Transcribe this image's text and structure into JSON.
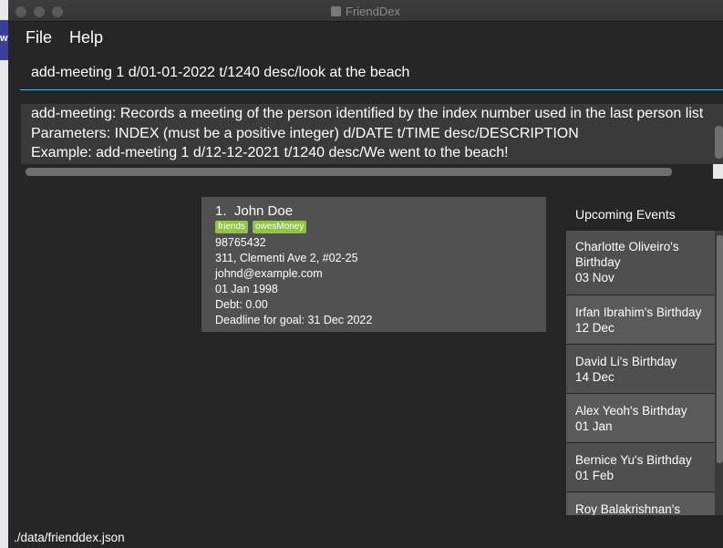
{
  "window": {
    "title": "FriendDex"
  },
  "menu": {
    "file": "File",
    "help": "Help"
  },
  "command_box": {
    "value": "add-meeting 1 d/01-01-2022 t/1240 desc/look at the beach"
  },
  "result_display": {
    "lines": [
      "add-meeting: Records a meeting of the person identified by the index number used in the last person list",
      "Parameters: INDEX (must be a positive integer) d/DATE t/TIME desc/DESCRIPTION",
      "Example: add-meeting 1 d/12-12-2021 t/1240 desc/We went to the beach!"
    ]
  },
  "person_list": [
    {
      "index": "1.",
      "name": "John Doe",
      "tags": [
        "friends",
        "owesMoney"
      ],
      "phone": "98765432",
      "address": "311, Clementi Ave 2, #02-25",
      "email": "johnd@example.com",
      "birthday": "01 Jan 1998",
      "debt": "Debt: 0.00",
      "goal_deadline": "Deadline for goal: 31 Dec 2022"
    }
  ],
  "upcoming_events": {
    "title": "Upcoming Events",
    "items": [
      {
        "label": "Charlotte Oliveiro's Birthday",
        "date": "03 Nov"
      },
      {
        "label": "Irfan Ibrahim's Birthday",
        "date": "12 Dec"
      },
      {
        "label": "David Li's Birthday",
        "date": "14 Dec"
      },
      {
        "label": "Alex Yeoh's Birthday",
        "date": "01 Jan"
      },
      {
        "label": "Bernice Yu's Birthday",
        "date": "01 Feb"
      },
      {
        "label": "Roy Balakrishnan's",
        "date": ""
      }
    ]
  },
  "status_bar": {
    "file_path": "./data/frienddex.json"
  },
  "background_app_fragment": "wi"
}
